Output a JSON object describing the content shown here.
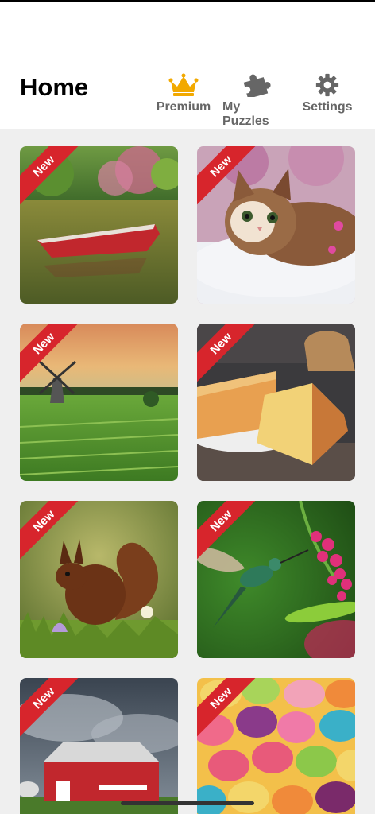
{
  "header": {
    "title": "Home",
    "premium_label": "Premium",
    "my_puzzles_label": "My Puzzles",
    "settings_label": "Settings",
    "premium_color": "#f2a900"
  },
  "badge_label": "New",
  "puzzles": [
    {
      "subject": "red rowboat on lake"
    },
    {
      "subject": "tabby kitten"
    },
    {
      "subject": "windmill in green field"
    },
    {
      "subject": "sponge cake"
    },
    {
      "subject": "red squirrel"
    },
    {
      "subject": "hummingbird with flowers"
    },
    {
      "subject": "red barn"
    },
    {
      "subject": "colorful macarons"
    }
  ]
}
